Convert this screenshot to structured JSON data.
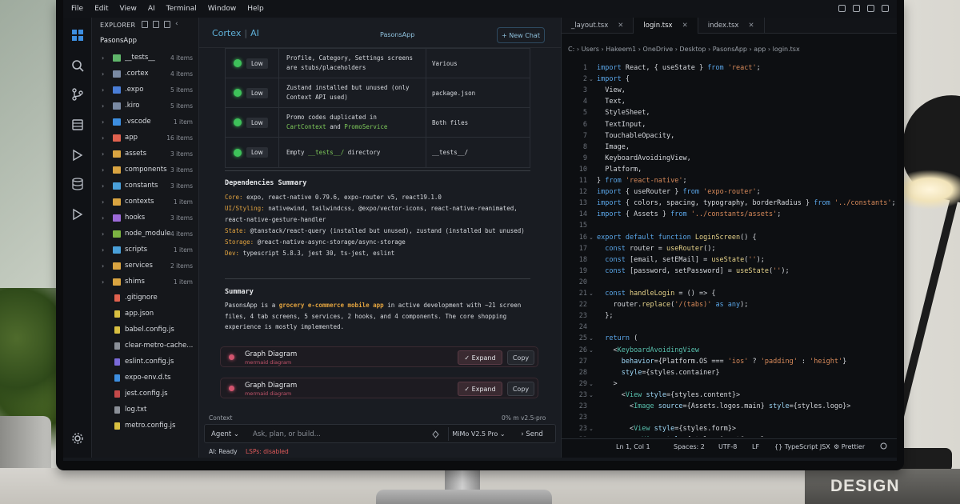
{
  "menu": [
    "File",
    "Edit",
    "View",
    "AI",
    "Terminal",
    "Window",
    "Help"
  ],
  "explorer": {
    "title": "EXPLORER",
    "project": "PasonsApp",
    "items": [
      {
        "name": "__tests__",
        "count": "4 items",
        "folder": true,
        "color": "#5fb56a"
      },
      {
        "name": ".cortex",
        "count": "4 items",
        "folder": true,
        "color": "#7a8aa3"
      },
      {
        "name": ".expo",
        "count": "5 items",
        "folder": true,
        "color": "#4a7dd6"
      },
      {
        "name": ".kiro",
        "count": "5 items",
        "folder": true,
        "color": "#7a8aa3"
      },
      {
        "name": ".vscode",
        "count": "1 item",
        "folder": true,
        "color": "#3d8ee0"
      },
      {
        "name": "app",
        "count": "16 items",
        "folder": true,
        "color": "#e0614f"
      },
      {
        "name": "assets",
        "count": "3 items",
        "folder": true,
        "color": "#d9a441"
      },
      {
        "name": "components",
        "count": "3 items",
        "folder": true,
        "color": "#d9a441"
      },
      {
        "name": "constants",
        "count": "3 items",
        "folder": true,
        "color": "#4aa0d9"
      },
      {
        "name": "contexts",
        "count": "1 item",
        "folder": true,
        "color": "#d9a441"
      },
      {
        "name": "hooks",
        "count": "3 items",
        "folder": true,
        "color": "#9d6ad9"
      },
      {
        "name": "node_modules",
        "count": "4 items",
        "folder": true,
        "color": "#7cb342"
      },
      {
        "name": "scripts",
        "count": "1 item",
        "folder": true,
        "color": "#4aa0d9"
      },
      {
        "name": "services",
        "count": "2 items",
        "folder": true,
        "color": "#d9a441"
      },
      {
        "name": "shims",
        "count": "1 item",
        "folder": true,
        "color": "#d9a441"
      },
      {
        "name": ".gitignore",
        "count": "",
        "folder": false,
        "color": "#e0614f"
      },
      {
        "name": "app.json",
        "count": "",
        "folder": false,
        "color": "#d9c041"
      },
      {
        "name": "babel.config.js",
        "count": "",
        "folder": false,
        "color": "#d9c041"
      },
      {
        "name": "clear-metro-cache...",
        "count": "",
        "folder": false,
        "color": "#8b9098"
      },
      {
        "name": "eslint.config.js",
        "count": "",
        "folder": false,
        "color": "#7a6ad9"
      },
      {
        "name": "expo-env.d.ts",
        "count": "",
        "folder": false,
        "color": "#3d8ee0"
      },
      {
        "name": "jest.config.js",
        "count": "",
        "folder": false,
        "color": "#c44a4a"
      },
      {
        "name": "log.txt",
        "count": "",
        "folder": false,
        "color": "#8b9098"
      },
      {
        "name": "metro.config.js",
        "count": "",
        "folder": false,
        "color": "#d9c041"
      }
    ]
  },
  "chat": {
    "brand": "Cortex",
    "brand_ai": "AI",
    "app_title": "PasonsApp",
    "new_chat": "+ New Chat",
    "issues": [
      {
        "severity": "Low",
        "desc": "Profile, Category, Settings screens are stubs/placeholders",
        "loc": "Various"
      },
      {
        "severity": "Low",
        "desc": "Zustand installed but unused (only Context API used)",
        "loc": "package.json"
      },
      {
        "severity": "Low",
        "desc_a": "Promo codes duplicated in",
        "desc_b": "CartContext",
        "desc_c": "and",
        "desc_d": "PromoService",
        "loc": "Both files"
      },
      {
        "severity": "Low",
        "desc_a": "Empty",
        "desc_b": "__tests__/",
        "desc_c": "directory",
        "loc": "__tests__/"
      }
    ],
    "deps_title": "Dependencies Summary",
    "deps": [
      {
        "label": "Core:",
        "value": "expo, react-native 0.79.6, expo-router v5, react19.1.0"
      },
      {
        "label": "UI/Styling:",
        "value": "nativewind, tailwindcss, @expo/vector-icons, react-native-reanimated, react-native-gesture-handler"
      },
      {
        "label": "State:",
        "value": "@tanstack/react-query (installed but unused), zustand (installed but unused)"
      },
      {
        "label": "Storage:",
        "value": "@react-native-async-storage/async-storage"
      },
      {
        "label": "Dev:",
        "value": "typescript 5.8.3, jest 30, ts-jest, eslint"
      }
    ],
    "summary_title": "Summary",
    "summary": {
      "a": "PasonsApp is a ",
      "b": "grocery e-commerce mobile app",
      "c": " in active development with ~21 screen files, 4 tab screens, 5 services, 2 hooks, and 4 components. The core shopping experience is mostly implemented."
    },
    "cards": [
      {
        "title": "Graph Diagram",
        "sub": "mermaid diagram",
        "expand": "✓ Expand",
        "copy": "Copy"
      },
      {
        "title": "Graph Diagram",
        "sub": "mermaid diagram",
        "expand": "✓ Expand",
        "copy": "Copy"
      }
    ],
    "context_label": "Context",
    "context_right": "0%  m v2.5-pro",
    "mode": "Agent ⌄",
    "placeholder": "Ask, plan, or build...",
    "model": "MiMo V2.5 Pro ⌄",
    "send": "› Send",
    "status_ready": "AI: Ready",
    "status_lsp": "LSPs: disabled"
  },
  "editor": {
    "tabs": [
      {
        "label": "_layout.tsx",
        "active": false
      },
      {
        "label": "login.tsx",
        "active": true
      },
      {
        "label": "index.tsx",
        "active": false
      }
    ],
    "breadcrumb": "C:   ›  Users  ›  Hakeem1  ›  OneDrive  ›  Desktop  ›  PasonsApp  ›  app  ›  login.tsx",
    "status": {
      "pos": "Ln 1, Col 1",
      "spaces": "Spaces: 2",
      "enc": "UTF-8",
      "eol": "LF",
      "lang": "{}   TypeScript JSX",
      "fmt": "⚙  Prettier"
    }
  },
  "book": "DESIGN",
  "colors": {
    "accent": "#5fb0d8",
    "ok": "#3ec25a",
    "error": "#e05a5a",
    "diagram": "#d2546e"
  }
}
